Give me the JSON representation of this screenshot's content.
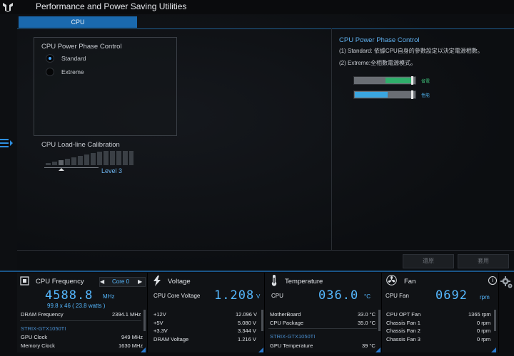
{
  "app": {
    "title": "Performance and Power Saving Utilities"
  },
  "tabs": [
    {
      "label": "CPU"
    }
  ],
  "phase_control": {
    "title": "CPU Power Phase Control",
    "options": [
      {
        "label": "Standard",
        "selected": true
      },
      {
        "label": "Extreme",
        "selected": false
      }
    ]
  },
  "llc": {
    "title": "CPU Load-line Calibration",
    "level": "Level 3"
  },
  "description": {
    "title": "CPU Power Phase Control",
    "line1": "(1) Standard: 依據CPU自身的參數設定以決定電源相數。",
    "line2": "(2) Extreme:全相數電源模式。",
    "bar1_label": "省電",
    "bar1_fill": 0.5,
    "bar2_label": "性能",
    "bar2_fill": 0.55,
    "colors": {
      "bar1": "#2fae6a",
      "bar2": "#3aa6e0",
      "accent": "#5fb0ee"
    }
  },
  "buttons": {
    "undo": "還原",
    "apply": "套用"
  },
  "monitor": {
    "cpu_freq": {
      "title": "CPU Frequency",
      "core_select": "Core 0",
      "value": "4588.8",
      "unit": "MHz",
      "sub": "99.8  x  46    ( 23.8   watts )",
      "dram_label": "DRAM Frequency",
      "dram_value": "2394.1  MHz",
      "gpu_name": "STRIX-GTX1050TI",
      "gpu_clock_label": "GPU Clock",
      "gpu_clock_value": "949 MHz",
      "mem_clock_label": "Memory Clock",
      "mem_clock_value": "1630 MHz"
    },
    "voltage": {
      "title": "Voltage",
      "core_label": "CPU Core Voltage",
      "value": "1.208",
      "unit": "V",
      "rows": [
        {
          "label": "+12V",
          "value": "12.096  V"
        },
        {
          "label": "+5V",
          "value": "5.080  V"
        },
        {
          "label": "+3.3V",
          "value": "3.344  V"
        },
        {
          "label": "DRAM Voltage",
          "value": "1.216  V"
        }
      ]
    },
    "temperature": {
      "title": "Temperature",
      "cpu_label": "CPU",
      "value": "036.0",
      "unit": "°C",
      "rows": [
        {
          "label": "MotherBoard",
          "value": "33.0 °C"
        },
        {
          "label": "CPU Package",
          "value": "35.0 °C"
        }
      ],
      "gpu_name": "STRIX-GTX1050TI",
      "gpu_temp_label": "GPU Temperature",
      "gpu_temp_value": "39 °C"
    },
    "fan": {
      "title": "Fan",
      "cpu_label": "CPU Fan",
      "value": "0692",
      "unit": "rpm",
      "rows": [
        {
          "label": "CPU OPT Fan",
          "value": "1365  rpm"
        },
        {
          "label": "Chassis Fan 1",
          "value": "0  rpm"
        },
        {
          "label": "Chassis Fan 2",
          "value": "0  rpm"
        },
        {
          "label": "Chassis Fan 3",
          "value": "0  rpm"
        }
      ]
    }
  }
}
